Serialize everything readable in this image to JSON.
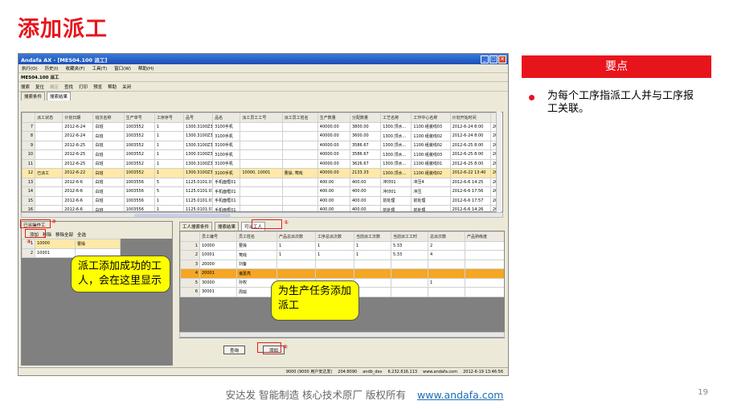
{
  "slide_title": "添加派工",
  "window": {
    "title": "Andafa AX - [MES04.100 派工]",
    "menu": [
      "执行(O)",
      "历史(I)",
      "收藏夹(F)",
      "工具(T)",
      "窗口(W)",
      "帮助(H)"
    ],
    "doc_label": "MES04.100 派工",
    "toolbar": [
      "搜索",
      "复位",
      "确定",
      "查找",
      "打印",
      "预览",
      "帮助",
      "关闭"
    ],
    "tabs": [
      "搜索条件",
      "搜索结果"
    ]
  },
  "top_grid": {
    "headers": [
      "",
      "派工状态",
      "计划日期",
      "班次名称",
      "生产单号",
      "工序序号",
      "品号",
      "品名",
      "派工员工工号",
      "派工员工姓名",
      "生产数量",
      "分配数量",
      "工艺名称",
      "工作中心名称",
      "计划开始时间",
      ""
    ],
    "rows": [
      [
        "7",
        "",
        "2012-6-24",
        "白班",
        "1003552",
        "1",
        "1300.3100Z3A",
        "3100手机",
        "",
        "",
        "40000.00",
        "3800.00",
        "1300.顶水...",
        "1100.组装线03",
        "2012-6-24 8:00",
        "20"
      ],
      [
        "8",
        "",
        "2012-6-24",
        "白班",
        "1003552",
        "1",
        "1300.3100Z3A",
        "3100手机",
        "",
        "",
        "40000.00",
        "3600.00",
        "1300.顶水...",
        "1100.组装线02",
        "2012-6-24 8:00",
        "20"
      ],
      [
        "9",
        "",
        "2012-6-25",
        "白班",
        "1003552",
        "1",
        "1300.3100Z3A",
        "3100手机",
        "",
        "",
        "40000.00",
        "3586.67",
        "1300.顶水...",
        "1100.组装线02",
        "2012-6-25 8:00",
        "20"
      ],
      [
        "10",
        "",
        "2012-6-25",
        "白班",
        "1003552",
        "1",
        "1300.3100Z3A",
        "3100手机",
        "",
        "",
        "40000.00",
        "3586.67",
        "1300.顶水...",
        "1100.组装线03",
        "2012-6-25 8:00",
        "20"
      ],
      [
        "11",
        "",
        "2012-6-25",
        "白班",
        "1003552",
        "1",
        "1300.3100Z3A",
        "3100手机",
        "",
        "",
        "40000.00",
        "3626.67",
        "1300.顶水...",
        "1100.组装线01",
        "2012-6-25 8:00",
        "20"
      ],
      [
        "12",
        "已派工",
        "2012-6-22",
        "白班",
        "1003552",
        "1",
        "1300.3100Z3A",
        "3100手机",
        "10000, 10001",
        "曹操, 莺戏",
        "40000.00",
        "2133.33",
        "1300.顶水...",
        "1100.组装线02",
        "2012-6-22 13:40",
        "20"
      ],
      [
        "13",
        "",
        "2012-6-6",
        "白班",
        "1003556",
        "5",
        "1125.0101.01",
        "手机面框01",
        "",
        "",
        "400.00",
        "400.00",
        "冲印01",
        "冲压4",
        "2012-6-6 14:25",
        "20"
      ],
      [
        "14",
        "",
        "2012-6-6",
        "白班",
        "1003556",
        "5",
        "1125.0101.01",
        "手机面框01",
        "",
        "",
        "400.00",
        "400.00",
        "冲印01",
        "冲压",
        "2012-6-6 17:56",
        "20"
      ],
      [
        "15",
        "",
        "2012-6-6",
        "白班",
        "1003556",
        "1",
        "1125.0101.01",
        "手机面框01",
        "",
        "",
        "400.00",
        "400.00",
        "前处理",
        "前处理",
        "2012-6-6 17:57",
        "20"
      ],
      [
        "16",
        "",
        "2012-6-6",
        "白班",
        "1003556",
        "1",
        "1125.0101.01",
        "手机面框01",
        "",
        "",
        "400.00",
        "400.00",
        "前处理",
        "前处理",
        "2012-6-6 14:26",
        "20"
      ]
    ]
  },
  "left_panel": {
    "title": "已派操作工",
    "tools": [
      "添加",
      "移除",
      "移除全部",
      "全选"
    ],
    "headers": [
      "",
      "工号",
      "姓名"
    ],
    "rows": [
      [
        "1",
        "10000",
        "曹操"
      ],
      [
        "2",
        "10001",
        ""
      ]
    ]
  },
  "right_panel": {
    "tabs": [
      "工人搜索条件",
      "搜索结果",
      "可派工人"
    ],
    "headers": [
      "",
      "员工编号",
      "员工姓名",
      "产品总派次数",
      "工序总派次数",
      "当前派工次数",
      "当前派工工时",
      "总派次数",
      "产品熟练度"
    ],
    "rows": [
      [
        "1",
        "10000",
        "曹操",
        "1",
        "1",
        "1",
        "5.33",
        "2",
        ""
      ],
      [
        "2",
        "10001",
        "莺戏",
        "1",
        "1",
        "1",
        "5.33",
        "4",
        ""
      ],
      [
        "3",
        "20000",
        "刘备",
        "",
        "",
        "",
        "",
        "",
        ""
      ],
      [
        "4",
        "20001",
        "诸葛亮",
        "",
        "",
        "",
        "",
        "",
        ""
      ],
      [
        "5",
        "30000",
        "孙权",
        "",
        "",
        "",
        "",
        "1",
        ""
      ],
      [
        "6",
        "30001",
        "周瑜",
        "",
        "",
        "",
        "",
        "",
        ""
      ]
    ],
    "query_button": "查询",
    "add_button": "添加"
  },
  "status": [
    "9000 (9000 用户安达发)",
    "204:8090",
    "andb_dev",
    "6.232.616.113",
    "www.andafa.com",
    "2012-6-19 13:46:56"
  ],
  "annotations": {
    "c1": "①",
    "c2": "②",
    "c3": "③",
    "c4": "④",
    "callout_left": "派工添加成功的工人，会在这里显示",
    "callout_right": "为生产任务添加派工"
  },
  "key_points": {
    "header": "要点",
    "bullet": "为每个工序指派工人并与工序报工关联。"
  },
  "footer": {
    "text": "安达发   智能制造 核心技术原厂    版权所有",
    "link": "www.andafa.com",
    "page": "19"
  },
  "colors": {
    "accent": "#e8141c",
    "callout": "#ffff00",
    "selected_row": "#f5a623"
  }
}
